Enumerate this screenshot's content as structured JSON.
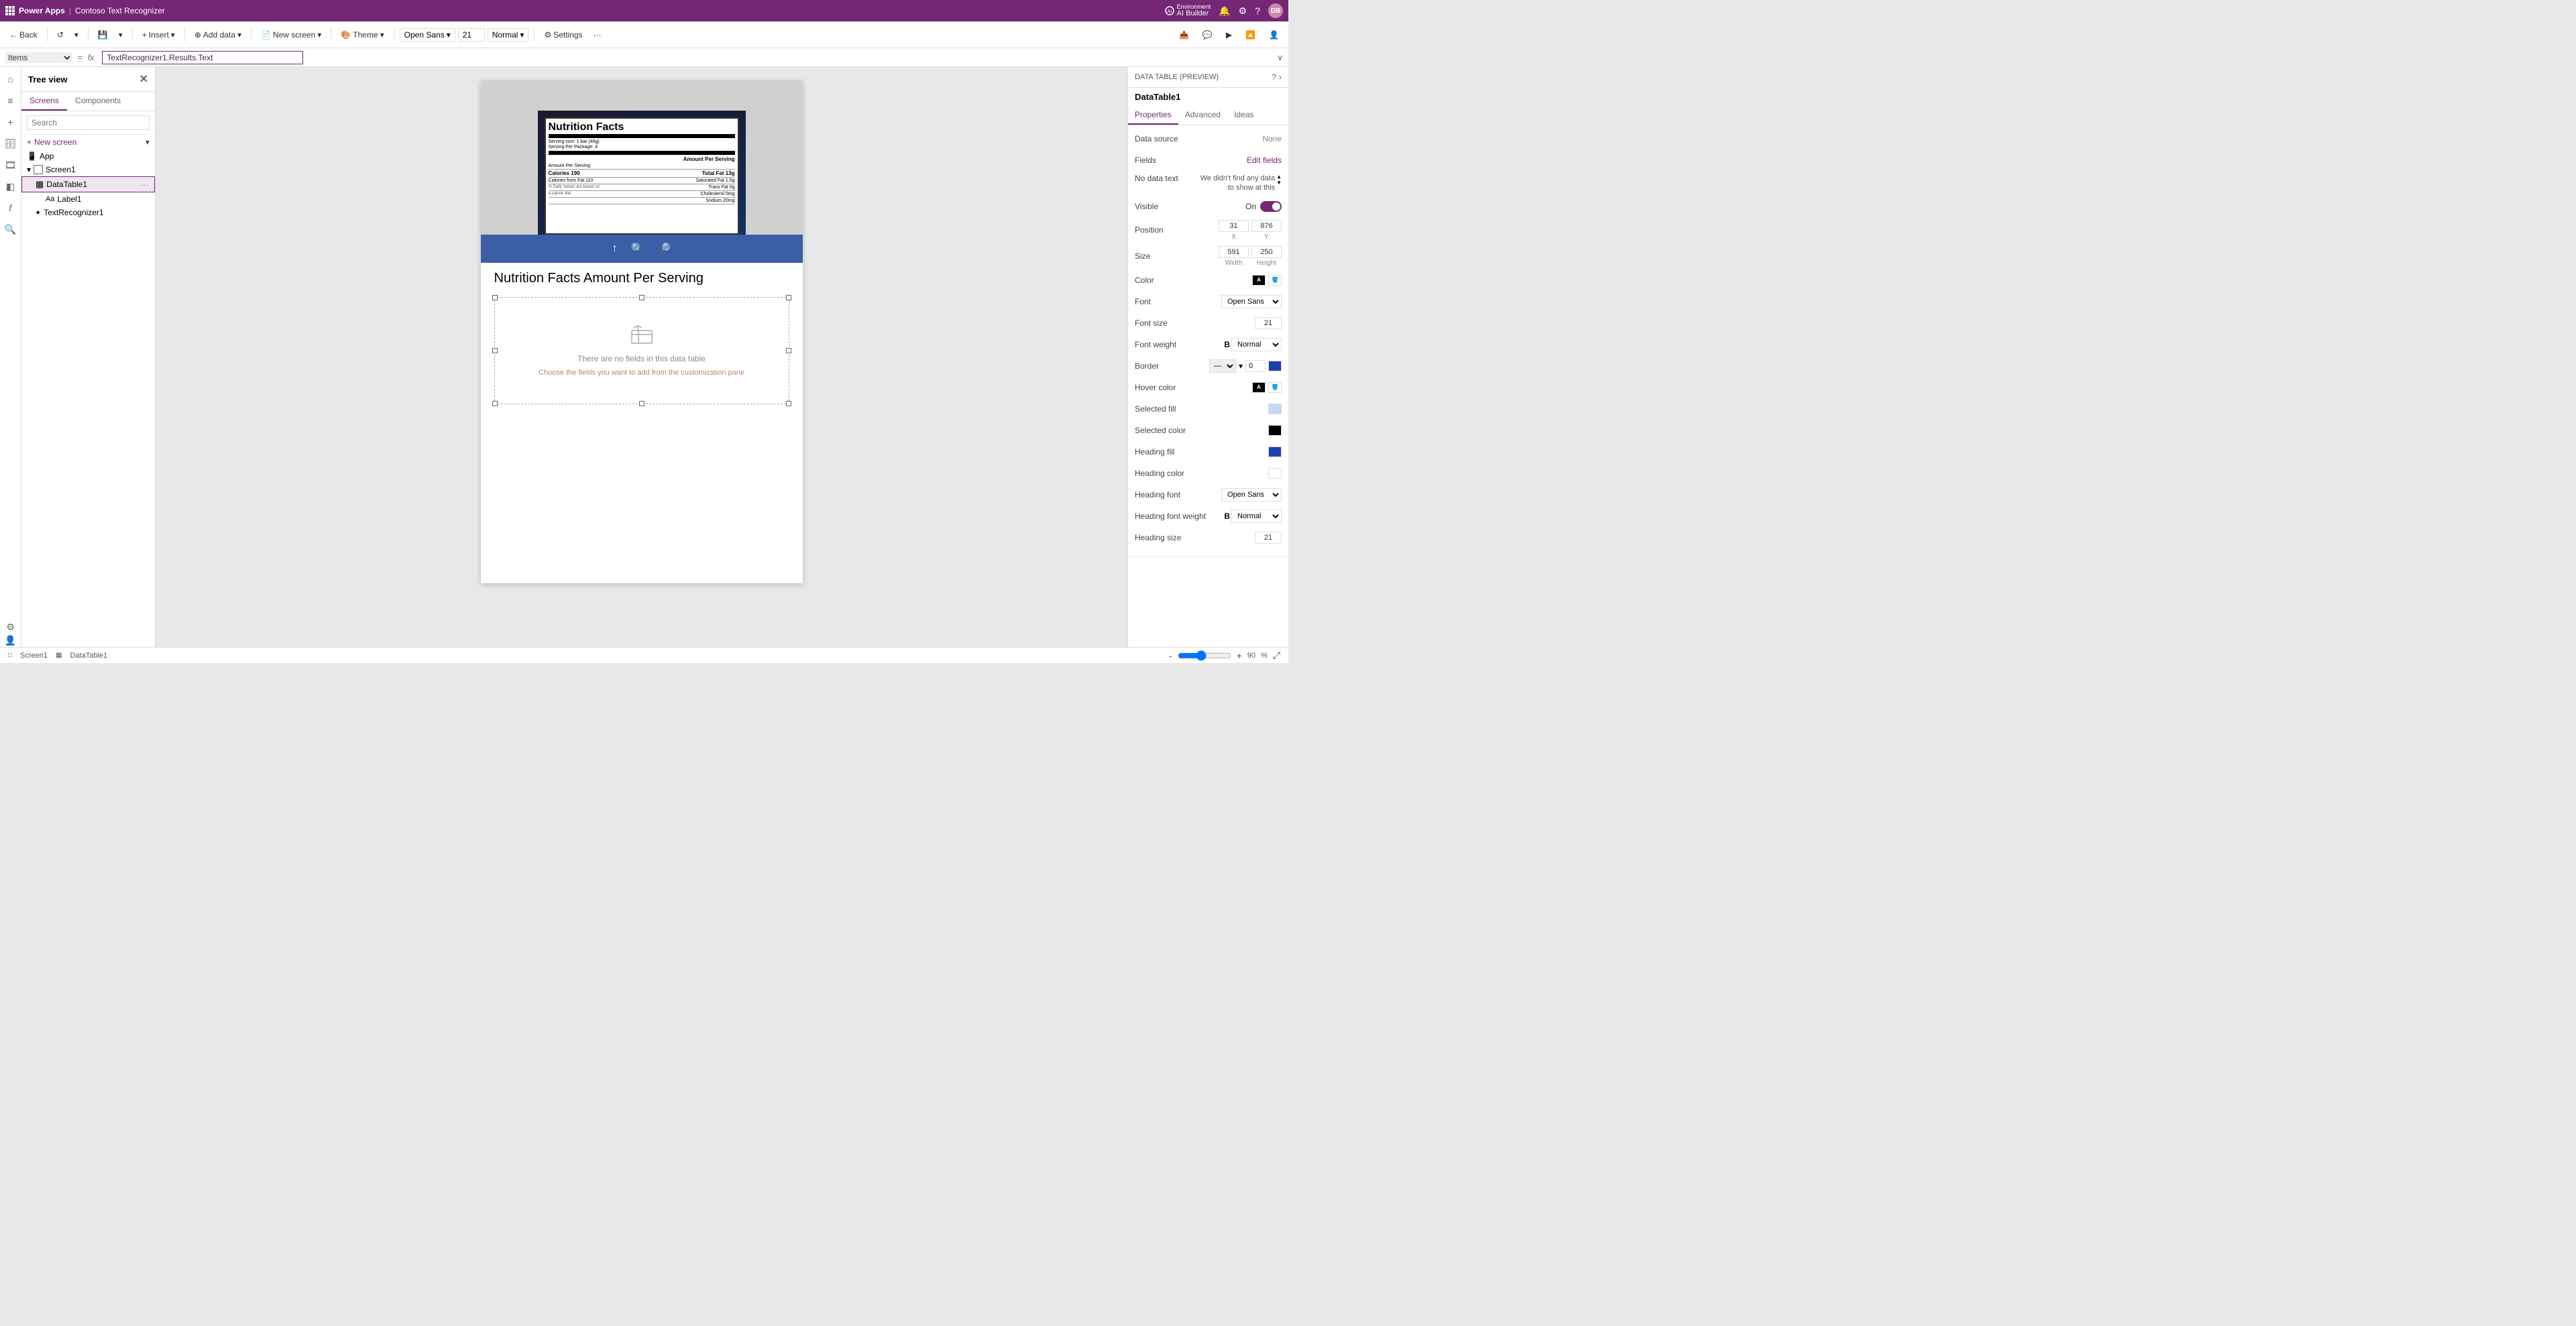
{
  "app": {
    "title": "Power Apps",
    "separator": "|",
    "project_name": "Contoso Text Recognizer"
  },
  "env": {
    "label": "Environment",
    "name": "AI Builder"
  },
  "toolbar": {
    "back": "Back",
    "insert": "Insert",
    "add_data": "Add data",
    "new_screen": "New screen",
    "theme": "Theme",
    "font": "Open Sans",
    "font_size": "21",
    "weight": "Normal",
    "settings": "Settings"
  },
  "formula": {
    "items_label": "Items",
    "formula_text": "TextRecognizer1.Results.Text"
  },
  "tree_view": {
    "title": "Tree view",
    "tabs": [
      "Screens",
      "Components"
    ],
    "active_tab": "Screens",
    "search_placeholder": "Search",
    "new_screen_label": "+ New screen",
    "items": [
      {
        "id": "app",
        "label": "App",
        "level": 0,
        "type": "app"
      },
      {
        "id": "screen1",
        "label": "Screen1",
        "level": 0,
        "type": "screen",
        "expanded": true
      },
      {
        "id": "datatable1",
        "label": "DataTable1",
        "level": 1,
        "type": "datatable",
        "selected": true
      },
      {
        "id": "label1",
        "label": "Label1",
        "level": 2,
        "type": "label"
      },
      {
        "id": "textrecognizer1",
        "label": "TextRecognizer1",
        "level": 1,
        "type": "textrecognizer"
      }
    ]
  },
  "canvas": {
    "heading": "Nutrition Facts Amount Per Serving",
    "datatable_empty_text1": "There are no fields in this data table",
    "datatable_empty_text2": "Choose the fields you want to add from the customization pane"
  },
  "right_panel": {
    "header": "DATA TABLE (PREVIEW)",
    "control_name": "DataTable1",
    "tabs": [
      "Properties",
      "Advanced",
      "Ideas"
    ],
    "active_tab": "Properties",
    "properties": {
      "data_source_label": "Data source",
      "data_source_value": "None",
      "fields_label": "Fields",
      "fields_edit": "Edit fields",
      "no_data_text_label": "No data text",
      "no_data_text_value": "We didn't find any data to show at this",
      "visible_label": "Visible",
      "visible_value": "On",
      "position_label": "Position",
      "pos_x": "31",
      "pos_y": "876",
      "pos_x_label": "X",
      "pos_y_label": "Y",
      "size_label": "Size",
      "width": "591",
      "height": "250",
      "width_label": "Width",
      "height_label": "Height",
      "color_label": "Color",
      "font_label": "Font",
      "font_value": "Open Sans",
      "font_size_label": "Font size",
      "font_size_value": "21",
      "font_weight_label": "Font weight",
      "font_weight_value": "Normal",
      "border_label": "Border",
      "border_size": "0",
      "hover_color_label": "Hover color",
      "selected_fill_label": "Selected fill",
      "selected_color_label": "Selected color",
      "heading_fill_label": "Heading fill",
      "heading_color_label": "Heading color",
      "heading_font_label": "Heading font",
      "heading_font_value": "Open Sans",
      "heading_font_weight_label": "Heading font weight",
      "heading_font_weight_value": "Normal",
      "heading_size_label": "Heading size",
      "heading_size_value": "21"
    },
    "colors": {
      "color_swatch": "#000000",
      "fill_swatch": "#ffffff",
      "hover_color": "#000000",
      "hover_fill": "#ffffff",
      "selected_fill": "#c5d5f5",
      "selected_color": "#000000",
      "heading_fill": "#1e40af",
      "heading_color": "#ffffff",
      "border_color": "#1e40af"
    }
  },
  "statusbar": {
    "screen_label": "Screen1",
    "datatable_label": "DataTable1",
    "zoom_minus": "-",
    "zoom_plus": "+",
    "zoom_value": "90",
    "zoom_percent": "%",
    "expand_icon": "⤢"
  }
}
